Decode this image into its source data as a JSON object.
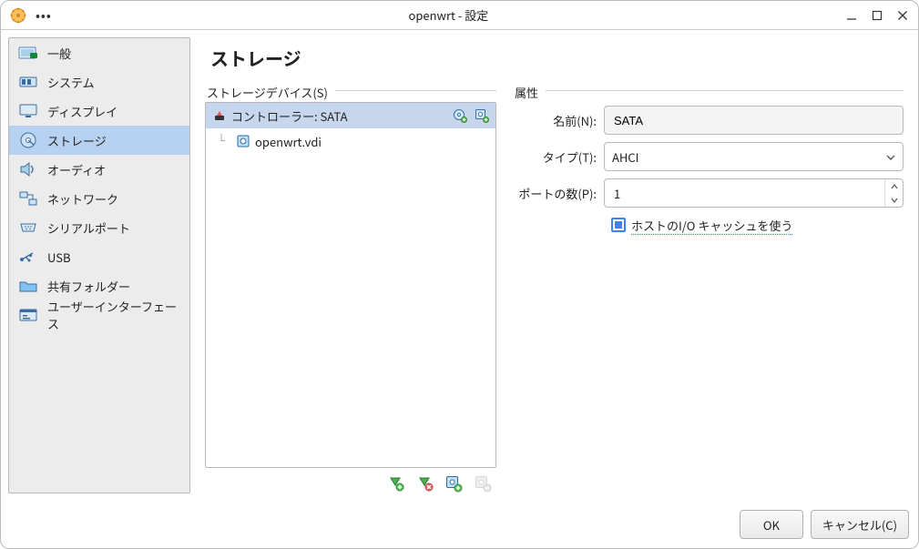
{
  "window": {
    "title": "openwrt - 設定"
  },
  "sidebar": {
    "items": [
      {
        "id": "general",
        "label": "一般"
      },
      {
        "id": "system",
        "label": "システム"
      },
      {
        "id": "display",
        "label": "ディスプレイ"
      },
      {
        "id": "storage",
        "label": "ストレージ"
      },
      {
        "id": "audio",
        "label": "オーディオ"
      },
      {
        "id": "network",
        "label": "ネットワーク"
      },
      {
        "id": "serial",
        "label": "シリアルポート"
      },
      {
        "id": "usb",
        "label": "USB"
      },
      {
        "id": "shared",
        "label": "共有フォルダー"
      },
      {
        "id": "ui",
        "label": "ユーザーインターフェース"
      }
    ],
    "selected": "storage"
  },
  "page": {
    "title": "ストレージ"
  },
  "storage_devices": {
    "group_title": "ストレージデバイス(S)",
    "controller_label": "コントローラー: SATA",
    "attachment_label": "openwrt.vdi"
  },
  "attributes": {
    "group_title": "属性",
    "name_label": "名前(N):",
    "name_value": "SATA",
    "type_label": "タイプ(T):",
    "type_value": "AHCI",
    "port_label": "ポートの数(P):",
    "port_value": "1",
    "io_cache_label": "ホストのI/O キャッシュを使う",
    "io_cache_checked": true
  },
  "buttons": {
    "ok": "OK",
    "cancel": "キャンセル(C)"
  }
}
